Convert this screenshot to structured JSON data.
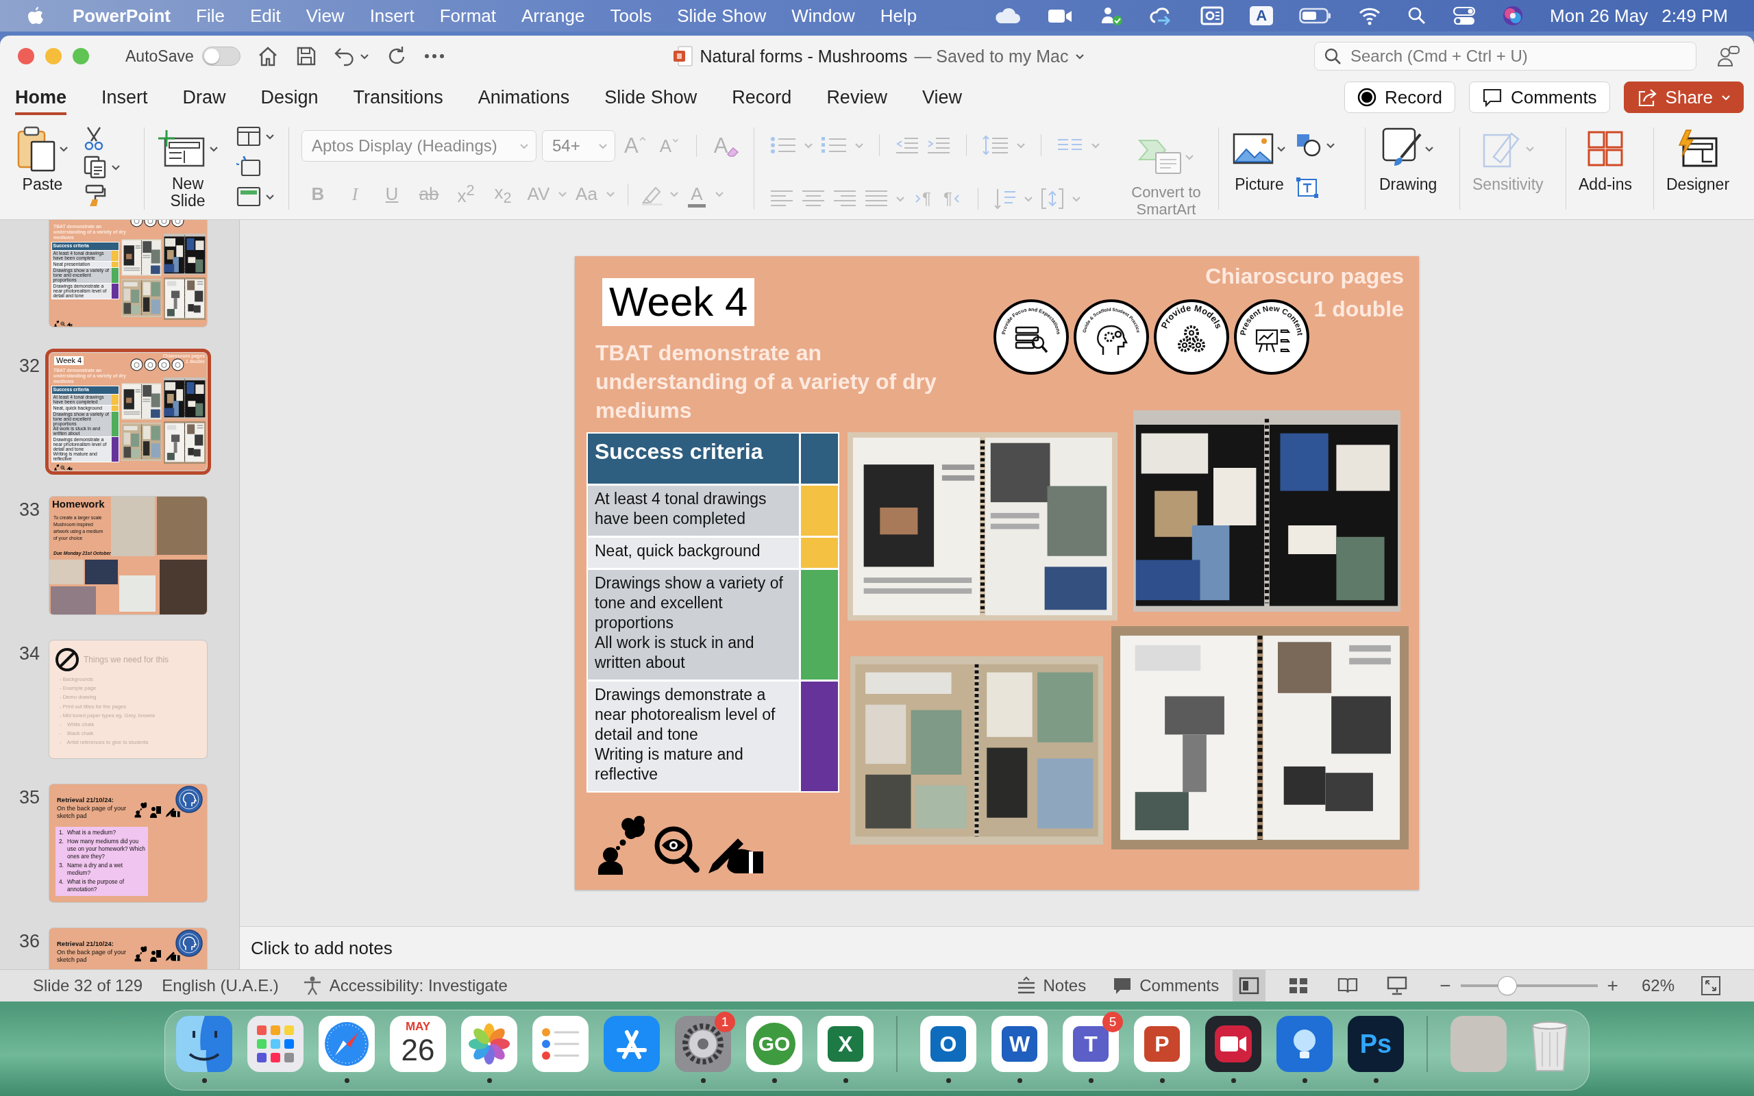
{
  "menu_bar": {
    "app": "PowerPoint",
    "menus": [
      "File",
      "Edit",
      "View",
      "Insert",
      "Format",
      "Arrange",
      "Tools",
      "Slide Show",
      "Window",
      "Help"
    ],
    "input_source": "A",
    "date": "Mon 26 May",
    "time": "2:49 PM"
  },
  "title_bar": {
    "autosave": {
      "label": "AutoSave",
      "on": false
    },
    "document": "Natural forms - Mushrooms",
    "save_status": "— Saved to my Mac",
    "search": {
      "placeholder": "Search (Cmd + Ctrl + U)"
    }
  },
  "ribbon_tabs": [
    {
      "label": "Home",
      "selected": true
    },
    {
      "label": "Insert",
      "selected": false
    },
    {
      "label": "Draw",
      "selected": false
    },
    {
      "label": "Design",
      "selected": false
    },
    {
      "label": "Transitions",
      "selected": false
    },
    {
      "label": "Animations",
      "selected": false
    },
    {
      "label": "Slide Show",
      "selected": false
    },
    {
      "label": "Record",
      "selected": false
    },
    {
      "label": "Review",
      "selected": false
    },
    {
      "label": "View",
      "selected": false
    }
  ],
  "ribbon_actions": [
    {
      "kind": "record",
      "label": "Record"
    },
    {
      "kind": "comments",
      "label": "Comments"
    },
    {
      "kind": "share",
      "label": "Share"
    }
  ],
  "ribbon": {
    "paste": "Paste",
    "new_slide": "New Slide",
    "font": {
      "disabled": true,
      "family": "Aptos Display (Headings)",
      "size": "54+",
      "grow": "A",
      "shrink": "A",
      "clear": "A",
      "styles": [
        {
          "kind": "bold",
          "label": "B"
        },
        {
          "kind": "italic",
          "label": "I"
        },
        {
          "kind": "underline",
          "label": "U"
        },
        {
          "kind": "strike",
          "label": "ab"
        },
        {
          "kind": "superscript",
          "label": "x$^{2}$"
        },
        {
          "kind": "subscript",
          "label": "x$_{2}$"
        },
        {
          "kind": "spacing",
          "label": "AV"
        },
        {
          "kind": "case",
          "label": "Aa"
        }
      ],
      "text_fill": "A"
    },
    "paragraph": {
      "disabled": true,
      "ltr": "¶",
      "rtl": "¶",
      "convert": "Convert to SmartArt"
    },
    "picture": "Picture",
    "drawing": "Drawing",
    "tools": [
      {
        "kind": "sensitivity",
        "label": "Sensitivity",
        "disabled": true
      },
      {
        "kind": "addins",
        "label": "Add-ins",
        "disabled": false
      },
      {
        "kind": "designer",
        "label": "Designer",
        "disabled": false
      }
    ]
  },
  "thumbnails": [
    {
      "kind": "lesson",
      "selected": false,
      "tbat": "TBAT demonstrate an understanding of a variety of dry mediums",
      "criteria": {
        "title": "Success criteria",
        "rows": [
          {
            "text": "At least 4 tonal drawings have been complete",
            "color": "#f4c142"
          },
          {
            "text": "Neat presentation",
            "color": "#f4c142"
          },
          {
            "text": "Drawings show a variety of tone and excellent proportions",
            "color": "#4fad5b"
          },
          {
            "text": "Drawings demonstrate a near photorealism level of detail and tone",
            "color": "#66339a"
          }
        ]
      }
    },
    {
      "number": "32",
      "kind": "lesson",
      "selected": true,
      "week": "Week 4",
      "note": [
        "Chiaroscuro pages",
        "1 double"
      ],
      "tbat": "TBAT demonstrate an understanding of a variety of dry mediums",
      "criteria": {
        "title": "Success criteria",
        "rows": [
          {
            "text": "At least 4 tonal drawings have been completed",
            "color": "#f4c142"
          },
          {
            "text": "Neat, quick background",
            "color": "#f4c142"
          },
          {
            "text": "Drawings show a variety of tone and excellent proportions\nAll work is stuck in and written about",
            "color": "#4fad5b"
          },
          {
            "text": "Drawings demonstrate a near photorealism level of detail and tone\nWriting is mature and reflective",
            "color": "#66339a"
          }
        ]
      }
    },
    {
      "number": "33",
      "kind": "homework",
      "selected": false,
      "title": "Homework",
      "text": "To create a larger scale Mushroom inspired artwork using a medium of your choice",
      "due": "Due Monday 21st October"
    },
    {
      "number": "34",
      "kind": "checklist",
      "selected": false,
      "title": "Things we need for this",
      "items": [
        "- Backgrounds",
        "- Example page",
        "- Demo drawing",
        "- Print out titles for the pages",
        "- Mid toned paper types eg. Grey, browns",
        "-    White chalk",
        "-    Black chalk",
        "-    Artist references to give to students"
      ]
    },
    {
      "number": "35",
      "kind": "retrieval",
      "selected": false,
      "title": "Retrieval 21/10/24:",
      "subtitle": "On the back page of your sketch pad",
      "questions": [
        {
          "number": "1.",
          "text": "What is a medium?"
        },
        {
          "number": "2.",
          "text": "How many mediums did you use on your homework? Which ones are they?"
        },
        {
          "number": "3.",
          "text": "Name a dry and a wet medium?"
        },
        {
          "number": "4.",
          "text": "What is the purpose of annotation?"
        }
      ]
    },
    {
      "number": "36",
      "kind": "retrieval",
      "selected": false,
      "title": "Retrieval 21/10/24:",
      "subtitle": "On the back page of your sketch pad"
    }
  ],
  "slide": {
    "week": "Week 4",
    "note": [
      "Chiaroscuro pages",
      "1 double"
    ],
    "badges": [
      {
        "kind": "focus",
        "caption": "Provide Focus and Expectations"
      },
      {
        "kind": "scaffold",
        "caption": "Guide & Scaffold Student Practice"
      },
      {
        "kind": "models",
        "caption": "Provide Models"
      },
      {
        "kind": "content",
        "caption": "Present New Content"
      }
    ],
    "tbat": "TBAT demonstrate an understanding of a variety of dry mediums",
    "criteria": {
      "title": "Success criteria",
      "rows": [
        {
          "text": "At least 4 tonal drawings have been completed",
          "color": "#f4c142"
        },
        {
          "text": "Neat, quick background",
          "color": "#f4c142"
        },
        {
          "text": "Drawings show a variety of tone and excellent proportions\nAll work is stuck in and written about",
          "color": "#4fad5b"
        },
        {
          "text": "Drawings demonstrate a near photorealism level of detail and tone\nWriting is mature and reflective",
          "color": "#66339a"
        }
      ]
    }
  },
  "notes": {
    "placeholder": "Click to add notes"
  },
  "status_bar": {
    "slide_position": "Slide 32 of 129",
    "language": "English (U.A.E.)",
    "accessibility": "Accessibility: Investigate",
    "notes": "Notes",
    "comments": "Comments",
    "views": [
      {
        "kind": "normal",
        "selected": true
      },
      {
        "kind": "sorter",
        "selected": false
      },
      {
        "kind": "reading",
        "selected": false
      },
      {
        "kind": "slideshow",
        "selected": false
      }
    ],
    "zoom": {
      "zoom_out": "−",
      "level": 0.32,
      "zoom_in": "+",
      "label": "62%"
    }
  },
  "dock": {
    "groups": [
      {
        "items": [
          {
            "kind": "finder",
            "running": true
          },
          {
            "kind": "launchpad",
            "running": false
          },
          {
            "kind": "safari",
            "running": true
          },
          {
            "kind": "calendar",
            "month": "MAY",
            "day": "26",
            "running": false
          },
          {
            "kind": "photos",
            "running": true
          },
          {
            "kind": "reminders",
            "running": false
          },
          {
            "kind": "appstore",
            "running": false
          },
          {
            "kind": "settings",
            "badge": "1",
            "running": true
          },
          {
            "kind": "go",
            "label": "GO",
            "running": true
          },
          {
            "kind": "excel",
            "label": "X",
            "running": true
          }
        ]
      },
      {
        "items": [
          {
            "kind": "outlook",
            "label": "O",
            "running": true
          },
          {
            "kind": "word",
            "label": "W",
            "running": true
          },
          {
            "kind": "teams",
            "label": "T",
            "badge": "5",
            "running": true
          },
          {
            "kind": "powerpoint",
            "label": "P",
            "running": true
          },
          {
            "kind": "recorder",
            "running": true
          },
          {
            "kind": "bulb",
            "running": true
          },
          {
            "kind": "photoshop",
            "label": "Ps",
            "running": true
          }
        ]
      },
      {
        "items": [
          {
            "kind": "photo",
            "running": false
          },
          {
            "kind": "trash",
            "running": false
          }
        ]
      }
    ]
  }
}
